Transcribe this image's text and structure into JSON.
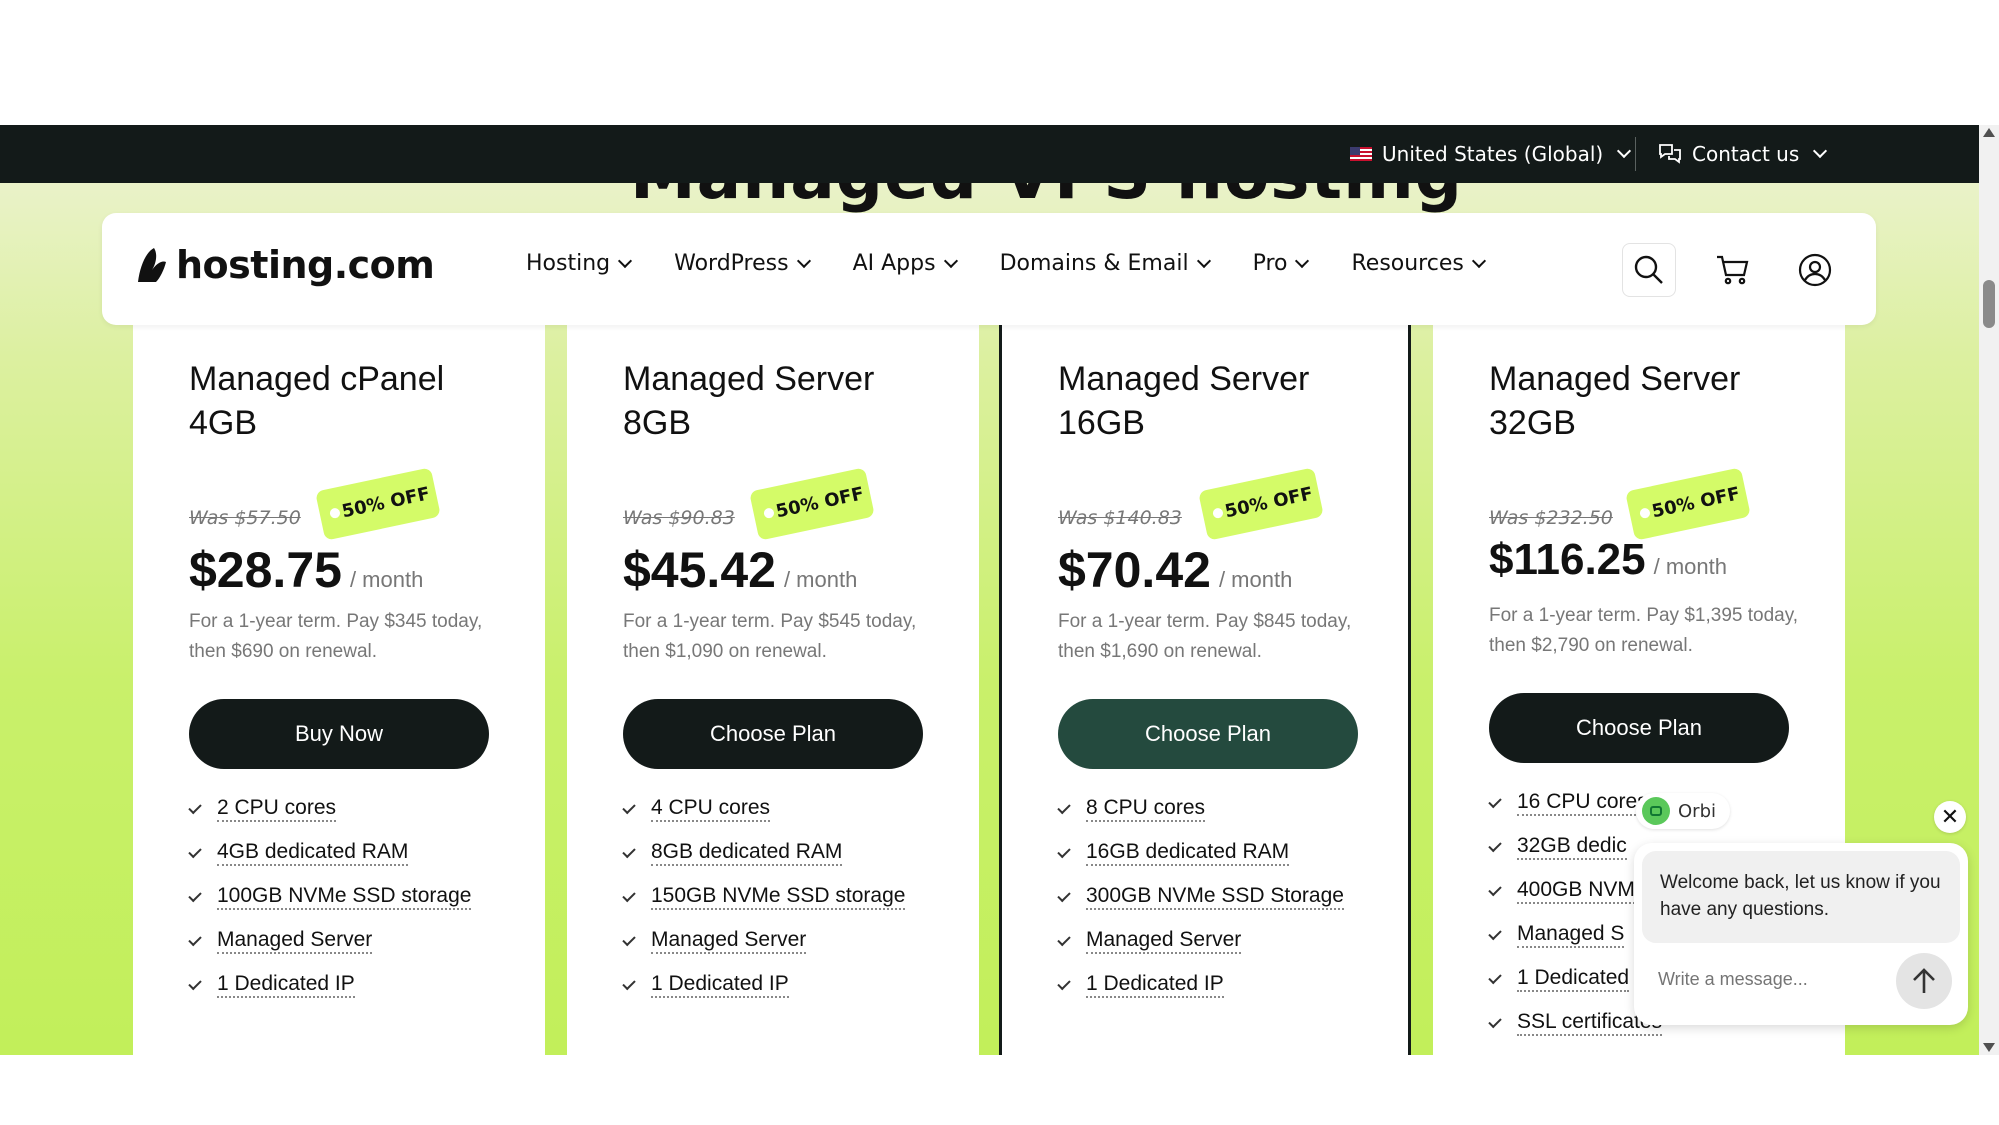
{
  "topbar": {
    "region_label": "United States (Global)",
    "contact_label": "Contact us"
  },
  "hero": {
    "title": "Managed VPS hosting"
  },
  "nav": {
    "logo_text": "hosting.com",
    "menu": [
      {
        "label": "Hosting"
      },
      {
        "label": "WordPress"
      },
      {
        "label": "AI Apps"
      },
      {
        "label": "Domains & Email"
      },
      {
        "label": "Pro"
      },
      {
        "label": "Resources"
      }
    ]
  },
  "plans": [
    {
      "title": "Managed cPanel 4GB",
      "was": "Was $57.50",
      "badge": "50% OFF",
      "price": "$28.75",
      "per": "/ month",
      "term": "For a 1-year term. Pay $345 today, then $690 on renewal.",
      "cta": "Buy Now",
      "features": [
        "2 CPU cores",
        "4GB dedicated RAM",
        "100GB NVMe SSD storage",
        "Managed Server",
        "1 Dedicated IP"
      ]
    },
    {
      "title": "Managed Server 8GB",
      "was": "Was $90.83",
      "badge": "50% OFF",
      "price": "$45.42",
      "per": "/ month",
      "term": "For a 1-year term. Pay $545 today, then $1,090 on renewal.",
      "cta": "Choose Plan",
      "features": [
        "4 CPU cores",
        "8GB dedicated RAM",
        "150GB NVMe SSD storage",
        "Managed Server",
        "1 Dedicated IP"
      ]
    },
    {
      "title": "Managed Server 16GB",
      "was": "Was $140.83",
      "badge": "50% OFF",
      "price": "$70.42",
      "per": "/ month",
      "term": "For a 1-year term. Pay $845 today, then $1,690 on renewal.",
      "cta": "Choose Plan",
      "features": [
        "8 CPU cores",
        "16GB dedicated RAM",
        "300GB NVMe SSD Storage",
        "Managed Server",
        "1 Dedicated IP"
      ]
    },
    {
      "title": "Managed Server 32GB",
      "was": "Was $232.50",
      "badge": "50% OFF",
      "price": "$116.25",
      "per": "/ month",
      "term": "For a 1-year term. Pay $1,395 today, then $2,790 on renewal.",
      "cta": "Choose Plan",
      "features": [
        "16 CPU cores",
        "32GB dedic",
        "400GB NVM",
        "Managed S",
        "1 Dedicated",
        "SSL certificates"
      ]
    }
  ],
  "chat": {
    "agent_name": "Orbi",
    "message": "Welcome back, let us know if you have any questions.",
    "input_placeholder": "Write a message...",
    "close_glyph": "✕"
  },
  "colors": {
    "topbar_bg": "#131a19",
    "accent_lime": "#c9f06b",
    "badge": "#d4fb68",
    "cta_dark": "#131a19",
    "cta_hover": "#244a3e"
  }
}
